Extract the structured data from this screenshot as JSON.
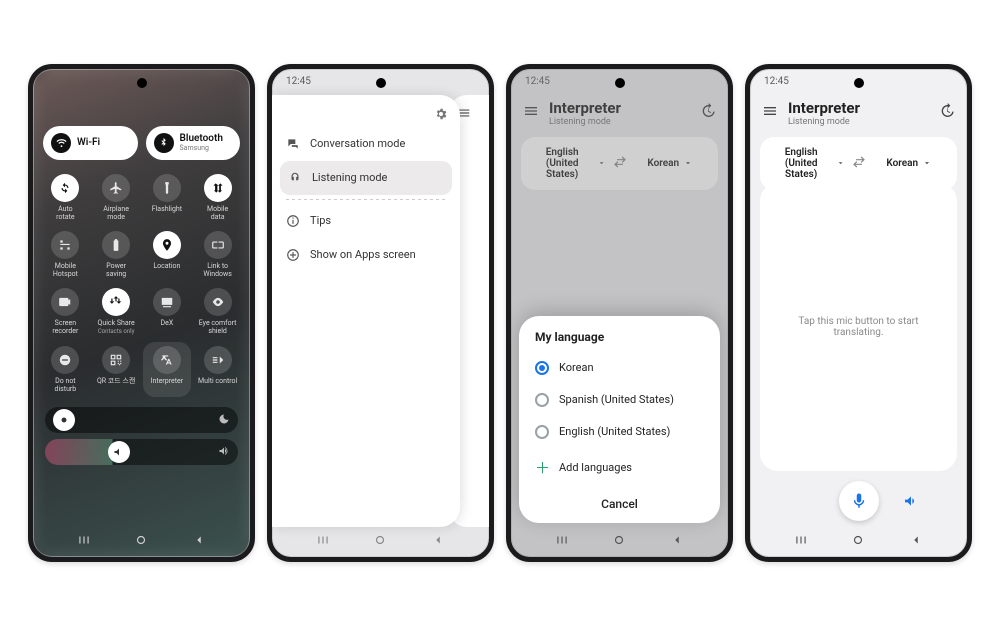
{
  "time": "12:45",
  "p1": {
    "wifi": {
      "label": "Wi-Fi"
    },
    "bt": {
      "label": "Bluetooth",
      "sub": "Samsung"
    },
    "tiles": [
      {
        "label": "Auto\nrotate",
        "on": true,
        "icon": "rotate"
      },
      {
        "label": "Airplane\nmode",
        "on": false,
        "icon": "plane"
      },
      {
        "label": "Flashlight",
        "on": false,
        "icon": "torch"
      },
      {
        "label": "Mobile\ndata",
        "on": true,
        "icon": "data"
      },
      {
        "label": "Mobile\nHotspot",
        "on": false,
        "icon": "hotspot"
      },
      {
        "label": "Power\nsaving",
        "on": false,
        "icon": "battery"
      },
      {
        "label": "Location",
        "on": true,
        "icon": "pin"
      },
      {
        "label": "Link to\nWindows",
        "on": false,
        "icon": "link"
      },
      {
        "label": "Screen\nrecorder",
        "on": false,
        "icon": "rec"
      },
      {
        "label": "Quick Share",
        "sub": "Contacts only",
        "on": true,
        "icon": "share"
      },
      {
        "label": "DeX",
        "on": false,
        "icon": "dex"
      },
      {
        "label": "Eye comfort\nshield",
        "on": false,
        "icon": "eye"
      },
      {
        "label": "Do not\ndisturb",
        "on": false,
        "icon": "dnd"
      },
      {
        "label": "QR 코드 스캔",
        "on": false,
        "icon": "qr"
      },
      {
        "label": "Interpreter",
        "on": false,
        "icon": "interp",
        "hl": true
      },
      {
        "label": "Multi control",
        "on": false,
        "icon": "multi"
      }
    ]
  },
  "p2": {
    "items": [
      {
        "label": "Conversation mode",
        "icon": "conv"
      },
      {
        "label": "Listening mode",
        "icon": "listen",
        "selected": true
      },
      {
        "label": "Tips",
        "icon": "tips"
      },
      {
        "label": "Show on Apps screen",
        "icon": "add"
      }
    ]
  },
  "interp": {
    "title": "Interpreter",
    "subtitle": "Listening mode",
    "lang_from": "English (United\nStates)",
    "lang_to": "Korean"
  },
  "sheet": {
    "title": "My language",
    "options": [
      "Korean",
      "Spanish (United States)",
      "English (United States)"
    ],
    "selected": 0,
    "add": "Add languages",
    "cancel": "Cancel"
  },
  "p4": {
    "hint": "Tap this mic button to start translating."
  }
}
